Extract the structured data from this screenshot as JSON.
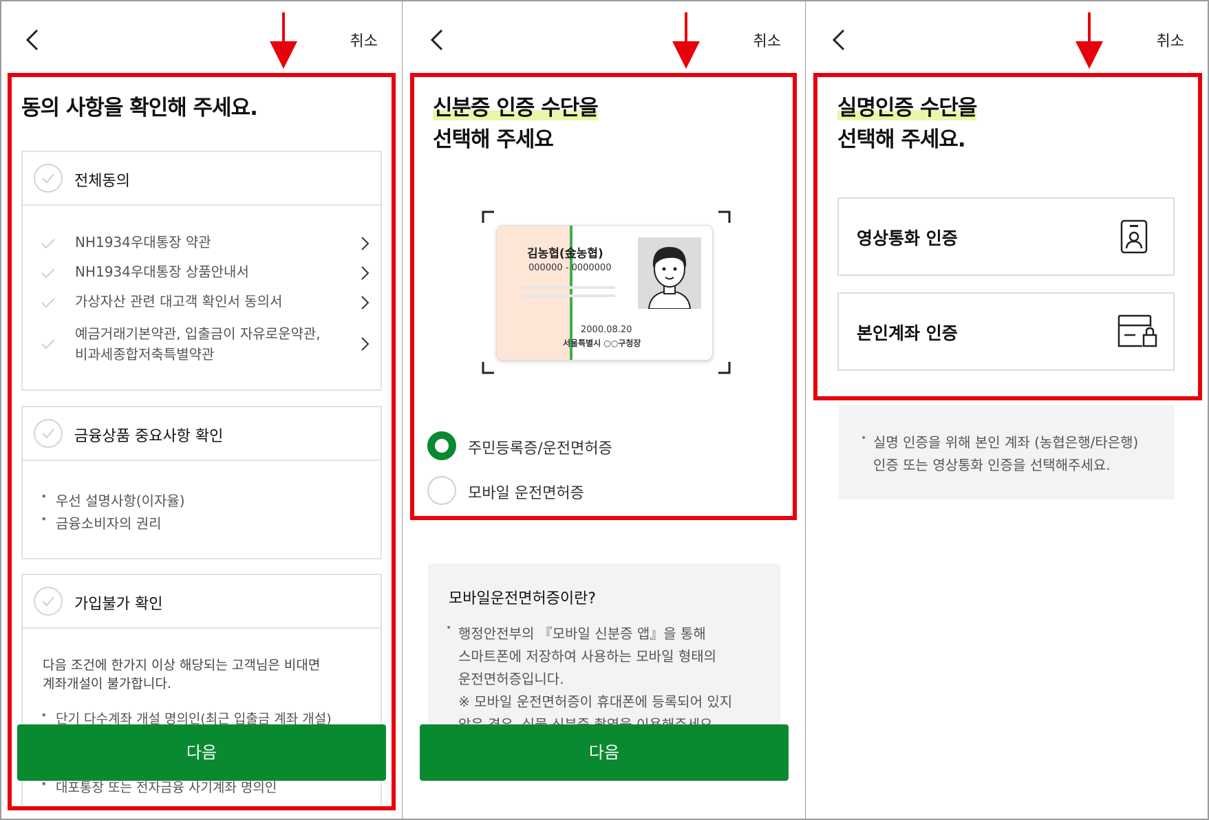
{
  "common": {
    "cancel_label": "취소",
    "next_label": "다음"
  },
  "panel1": {
    "title": "동의 사항을 확인해 주세요.",
    "all_agree": "전체동의",
    "terms": [
      "NH1934우대통장 약관",
      "NH1934우대통장 상품안내서",
      "가상자산 관련 대고객 확인서 동의서",
      "예금거래기본약관, 입출금이 자유로운약관,",
      "비과세종합저축특별약관"
    ],
    "financial_section": {
      "title": "금융상품 중요사항 확인",
      "items": [
        "우선 설명사항(이자율)",
        "금융소비자의 권리"
      ]
    },
    "ineligible_section": {
      "title": "가입불가 확인",
      "description_line1": "다음 조건에 한가지 이상 해당되는 고객님은 비대면",
      "description_line2": "계좌개설이 불가합니다.",
      "items": [
        "단기 다수계좌 개설 명의인(최근 입출금 계좌 개설)",
        "대포통장 또는 전자금융 사기계좌 명의인"
      ]
    }
  },
  "panel2": {
    "title_line1": "신분증 인증 수단을",
    "title_line2": "선택해 주세요",
    "id_card": {
      "name": "김농협(金농협)",
      "number": "000000 - 0000000",
      "date": "2000.08.20",
      "issuer": "서울특별시 ○○구청장"
    },
    "options": [
      "주민등록증/운전면허증",
      "모바일 운전면허증"
    ],
    "selected_option": 0,
    "info": {
      "title": "모바일운전면허증이란?",
      "line1": "행정안전부의 『모바일 신분증 앱』을 통해",
      "line2": "스마트폰에 저장하여 사용하는 모바일 형태의",
      "line3": "운전면허증입니다.",
      "line4": "※ 모바일 운전면허증이 휴대폰에 등록되어 있지",
      "line5": "않은 경우, 실물 신분증 촬영을 이용해주세요."
    }
  },
  "panel3": {
    "title_line1": "실명인증 수단을",
    "title_line2": "선택해 주세요.",
    "methods": [
      "영상통화 인증",
      "본인계좌 인증"
    ],
    "note_line1": "실명 인증을 위해 본인 계좌 (농협은행/타은행)",
    "note_line2": "인증 또는 영상통화 인증을 선택해주세요."
  },
  "colors": {
    "accent_green": "#0a8a30",
    "highlight_red": "#e8000b",
    "highlight_yellow": "#e8f7a8"
  }
}
